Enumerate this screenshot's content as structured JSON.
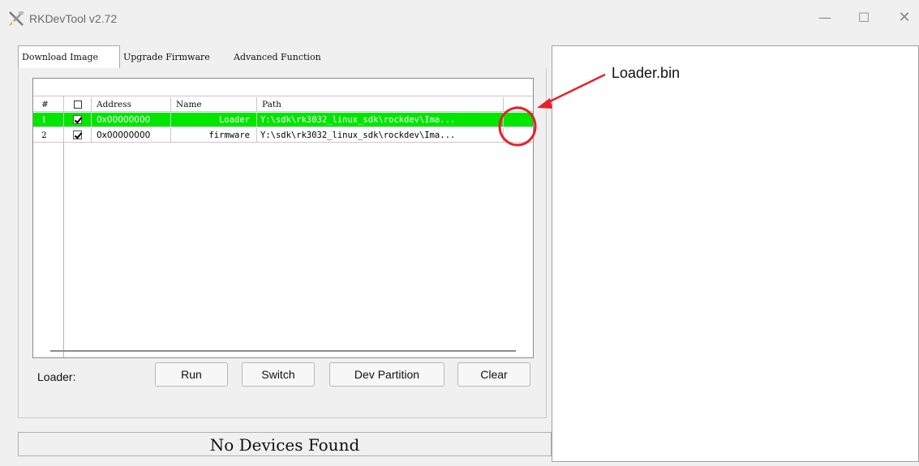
{
  "window": {
    "title": "RKDevTool v2.72",
    "controls": {
      "minimize": "—",
      "maximize": "☐",
      "close": "✕"
    }
  },
  "tabs": [
    {
      "label": "Download Image",
      "active": true
    },
    {
      "label": "Upgrade Firmware",
      "active": false
    },
    {
      "label": "Advanced Function",
      "active": false
    }
  ],
  "table": {
    "headers": {
      "index": "#",
      "address": "Address",
      "name": "Name",
      "path": "Path",
      "browse": "..."
    },
    "rows": [
      {
        "index": "1",
        "checked": true,
        "address": "0x00000000",
        "name": "Loader",
        "path": "Y:\\sdk\\rk3032_linux_sdk\\rockdev\\Ima...",
        "selected": true
      },
      {
        "index": "2",
        "checked": true,
        "address": "0x00000000",
        "name": "firmware",
        "path": "Y:\\sdk\\rk3032_linux_sdk\\rockdev\\Ima...",
        "selected": false
      }
    ]
  },
  "actions": {
    "loader_label": "Loader:",
    "run": "Run",
    "switch": "Switch",
    "dev_partition": "Dev Partition",
    "clear": "Clear"
  },
  "status": "No Devices Found",
  "annotation": {
    "label": "Loader.bin",
    "color": "#e8202a"
  },
  "colors": {
    "selected_row": "#00e600"
  }
}
